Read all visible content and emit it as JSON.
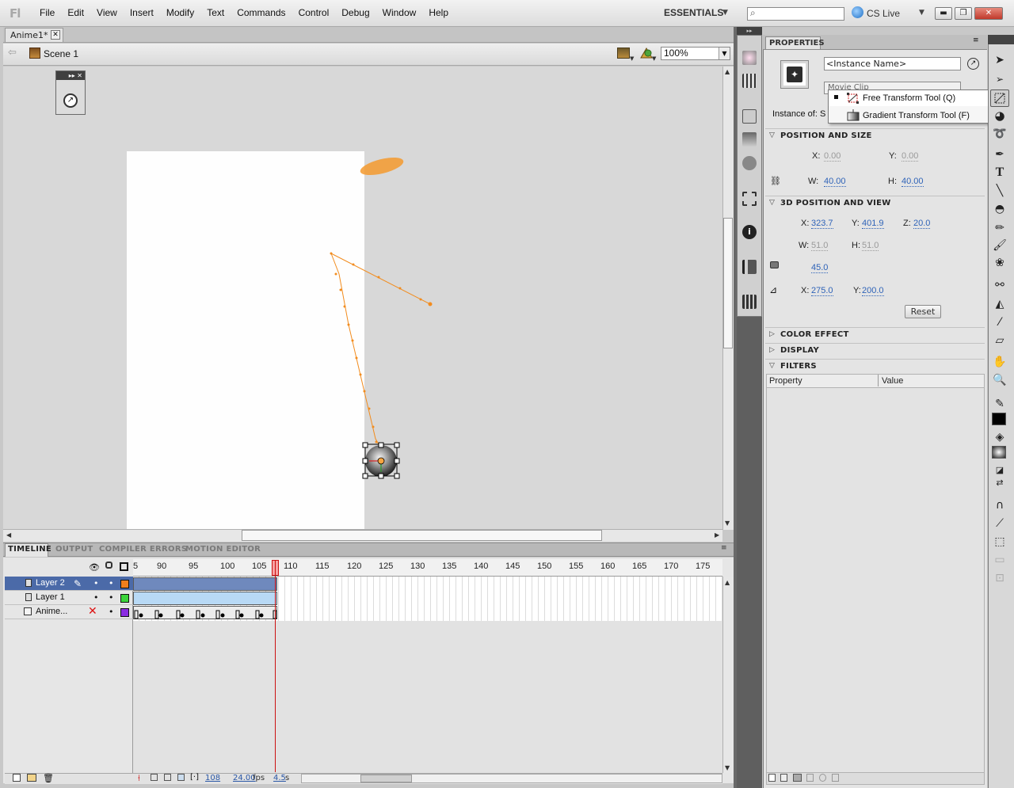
{
  "app": {
    "logo": "Fl"
  },
  "menu": [
    "File",
    "Edit",
    "View",
    "Insert",
    "Modify",
    "Text",
    "Commands",
    "Control",
    "Debug",
    "Window",
    "Help"
  ],
  "workspace": {
    "label": "ESSENTIALS",
    "search_placeholder": "",
    "cs_live": "CS Live"
  },
  "document": {
    "tab_title": "Anime1*"
  },
  "scene": {
    "name": "Scene 1",
    "zoom": "100%"
  },
  "timeline": {
    "tabs": [
      "TIMELINE",
      "OUTPUT",
      "COMPILER ERRORS",
      "MOTION EDITOR"
    ],
    "frame_numbers": [
      "5",
      "90",
      "95",
      "100",
      "105",
      "110",
      "115",
      "120",
      "125",
      "130",
      "135",
      "140",
      "145",
      "150",
      "155",
      "160",
      "165",
      "170",
      "175"
    ],
    "layers": [
      {
        "name": "Layer 2",
        "color": "#f07f1c",
        "selected": true
      },
      {
        "name": "Layer 1",
        "color": "#3bd43b",
        "selected": false
      },
      {
        "name": "Anime...",
        "color": "#8a2be2",
        "selected": false
      }
    ],
    "status": {
      "current_frame": "108",
      "fps_value": "24.00",
      "fps_unit": "fps",
      "time_value": "4.5",
      "time_unit": "s"
    }
  },
  "properties": {
    "tab": "PROPERTIES",
    "instance_name_placeholder": "<Instance Name>",
    "symbol_type": "Movie Clip",
    "instance_of_label": "Instance of:",
    "instance_of_value": "S",
    "sections": {
      "position_size": "POSITION AND SIZE",
      "position_3d": "3D POSITION AND VIEW",
      "color_effect": "COLOR EFFECT",
      "display": "DISPLAY",
      "filters": "FILTERS"
    },
    "pos": {
      "x_label": "X:",
      "x": "0.00",
      "y_label": "Y:",
      "y": "0.00",
      "w_label": "W:",
      "w": "40.00",
      "h_label": "H:",
      "h": "40.00"
    },
    "p3d": {
      "x_label": "X:",
      "x": "323.7",
      "y_label": "Y:",
      "y": "401.9",
      "z_label": "Z:",
      "z": "20.0",
      "w_label": "W:",
      "w": "51.0",
      "h_label": "H:",
      "h": "51.0",
      "persp": "45.0",
      "vx_label": "X:",
      "vx": "275.0",
      "vy_label": "Y:",
      "vy": "200.0"
    },
    "reset": "Reset",
    "filter_cols": [
      "Property",
      "Value"
    ]
  },
  "tool_menu": {
    "items": [
      "Free Transform Tool (Q)",
      "Gradient Transform Tool (F)"
    ]
  },
  "colors": {
    "accent_blue": "#2f63b8",
    "layer_selected": "#4b6aa8",
    "motion_path": "#f28c1e"
  }
}
